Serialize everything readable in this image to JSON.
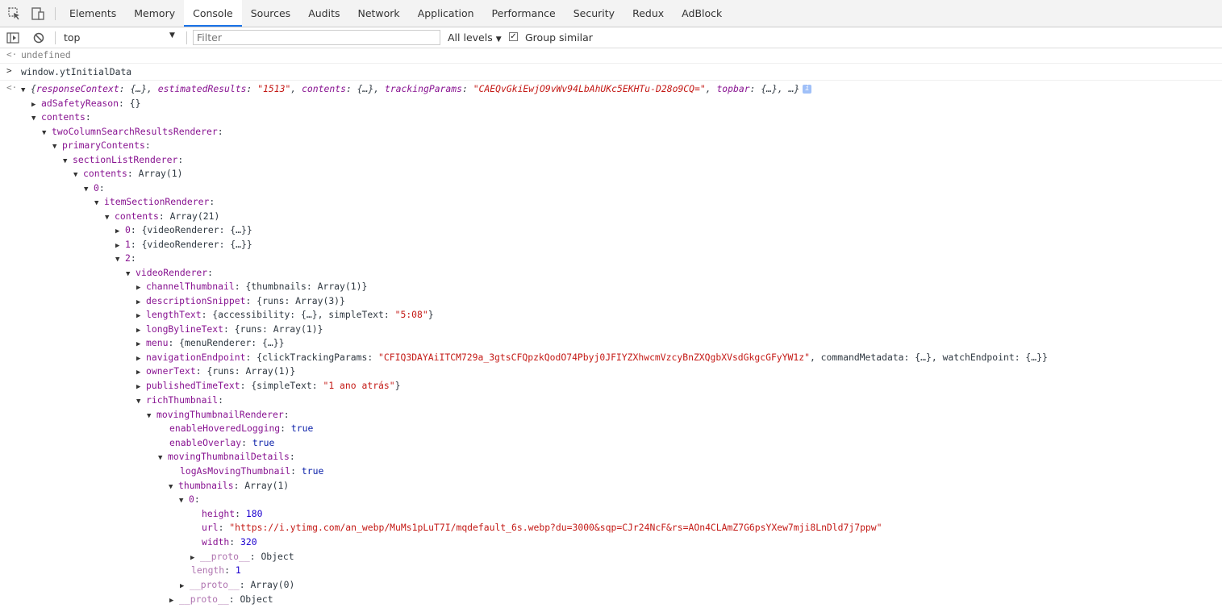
{
  "tabs": [
    "Elements",
    "Memory",
    "Console",
    "Sources",
    "Audits",
    "Network",
    "Application",
    "Performance",
    "Security",
    "Redux",
    "AdBlock"
  ],
  "active_tab": "Console",
  "toolbar": {
    "context": "top",
    "filter_placeholder": "Filter",
    "levels": "All levels",
    "group_similar": "Group similar"
  },
  "console": {
    "undefined": "undefined",
    "command": "window.ytInitialData",
    "summary": {
      "p1": "responseContext",
      "p1v": "{…}",
      "p2": "estimatedResults",
      "p2v": "\"1513\"",
      "p3": "contents",
      "p3v": "{…}",
      "p4": "trackingParams",
      "p4v": "\"CAEQvGkiEwjO9vWv94LbAhUKc5EKHTu-D28o9CQ=\"",
      "p5": "topbar",
      "p5v": "{…}",
      "tail": "…}"
    },
    "lines": {
      "adSafetyReason": "adSafetyReason",
      "adSafetyReason_v": "{}",
      "contents": "contents",
      "twoColumn": "twoColumnSearchResultsRenderer",
      "primaryContents": "primaryContents",
      "sectionList": "sectionListRenderer",
      "contents2": "contents",
      "contents2_v": "Array(1)",
      "idx0": "0",
      "itemSection": "itemSectionRenderer",
      "contents3": "contents",
      "contents3_v": "Array(21)",
      "i0": "0",
      "i0_v": "{videoRenderer: {…}}",
      "i1": "1",
      "i1_v": "{videoRenderer: {…}}",
      "i2": "2",
      "videoRenderer": "videoRenderer",
      "channelThumbnail": "channelThumbnail",
      "channelThumbnail_v": "{thumbnails: Array(1)}",
      "descriptionSnippet": "descriptionSnippet",
      "descriptionSnippet_v": "{runs: Array(3)}",
      "lengthText": "lengthText",
      "lengthText_v1": "{accessibility: {…}, simpleText: ",
      "lengthText_s": "\"5:08\"",
      "lengthText_v2": "}",
      "longBylineText": "longBylineText",
      "longBylineText_v": "{runs: Array(1)}",
      "menu": "menu",
      "menu_v": "{menuRenderer: {…}}",
      "navigationEndpoint": "navigationEndpoint",
      "nav_v1": "{clickTrackingParams: ",
      "nav_s": "\"CFIQ3DAYAiITCM729a_3gtsCFQpzkQodO74Pbyj0JFIYZXhwcmVzcyBnZXQgbXVsdGkgcGFyYW1z\"",
      "nav_v2": ", commandMetadata: {…}, watchEndpoint: {…}}",
      "ownerText": "ownerText",
      "ownerText_v": "{runs: Array(1)}",
      "publishedTimeText": "publishedTimeText",
      "pub_v1": "{simpleText: ",
      "pub_s": "\"1 ano atrás\"",
      "pub_v2": "}",
      "richThumbnail": "richThumbnail",
      "movingRenderer": "movingThumbnailRenderer",
      "enableHoveredLogging": "enableHoveredLogging",
      "enableHoveredLogging_v": "true",
      "enableOverlay": "enableOverlay",
      "enableOverlay_v": "true",
      "movingDetails": "movingThumbnailDetails",
      "logAsMoving": "logAsMovingThumbnail",
      "logAsMoving_v": "true",
      "thumbnails": "thumbnails",
      "thumbnails_v": "Array(1)",
      "t0": "0",
      "height": "height",
      "height_v": "180",
      "url": "url",
      "url_v": "\"https://i.ytimg.com/an_webp/MuMs1pLuT7I/mqdefault_6s.webp?du=3000&sqp=CJr24NcF&rs=AOn4CLAmZ7G6psYXew7mji8LnDld7j7ppw\"",
      "width": "width",
      "width_v": "320",
      "proto1": "__proto__",
      "proto1_v": "Object",
      "length": "length",
      "length_v": "1",
      "proto2": "__proto__",
      "proto2_v": "Array(0)",
      "proto3": "__proto__",
      "proto3_v": "Object"
    }
  }
}
